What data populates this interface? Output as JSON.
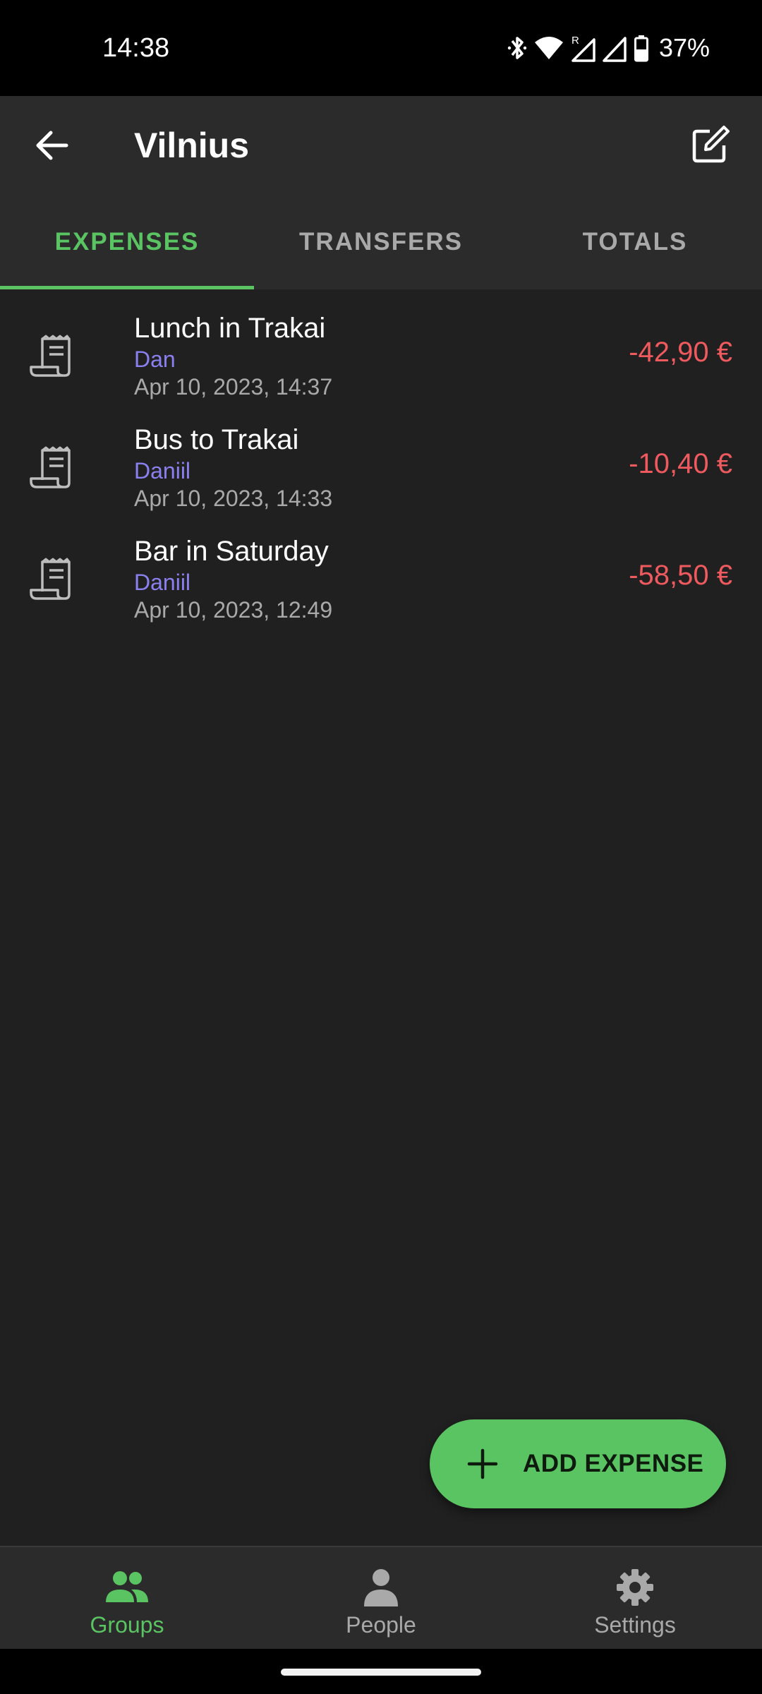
{
  "status_bar": {
    "time": "14:38",
    "battery": "37%",
    "icons": [
      "bluetooth-icon",
      "wifi-icon",
      "roaming-signal-icon",
      "signal-icon",
      "battery-icon"
    ]
  },
  "app_bar": {
    "title": "Vilnius",
    "back_icon": "arrow-back-icon",
    "edit_icon": "edit-icon"
  },
  "tabs": [
    {
      "label": "EXPENSES",
      "active": true
    },
    {
      "label": "TRANSFERS",
      "active": false
    },
    {
      "label": "TOTALS",
      "active": false
    }
  ],
  "expenses": [
    {
      "title": "Lunch in Trakai",
      "payer": "Dan",
      "date": "Apr 10, 2023, 14:37",
      "amount": "-42,90 €",
      "icon": "receipt-icon"
    },
    {
      "title": "Bus to Trakai",
      "payer": "Daniil",
      "date": "Apr 10, 2023, 14:33",
      "amount": "-10,40 €",
      "icon": "receipt-icon"
    },
    {
      "title": "Bar in Saturday",
      "payer": "Daniil",
      "date": "Apr 10, 2023, 12:49",
      "amount": "-58,50 €",
      "icon": "receipt-icon"
    }
  ],
  "fab": {
    "label": "ADD EXPENSE",
    "icon": "plus-icon"
  },
  "bottom_nav": [
    {
      "label": "Groups",
      "icon": "groups-icon",
      "active": true
    },
    {
      "label": "People",
      "icon": "person-icon",
      "active": false
    },
    {
      "label": "Settings",
      "icon": "gear-icon",
      "active": false
    }
  ],
  "colors": {
    "accent": "#5ac463",
    "amount_negative": "#ef5a5f",
    "payer": "#8b80f0",
    "background": "#202020",
    "surface": "#2b2b2b"
  }
}
